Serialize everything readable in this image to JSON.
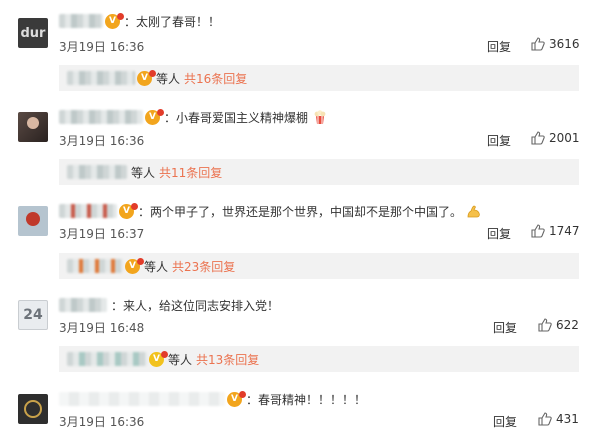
{
  "comments": [
    {
      "text": "：太刚了春哥！！",
      "time": "3月19日 16:36",
      "reply_label": "回复",
      "likes": "3616",
      "avatar_text": "dur",
      "vip_badge": "V",
      "sub": {
        "suffix_text": "等人",
        "count_text": "共16条回复"
      }
    },
    {
      "text": "：小春哥爱国主义精神爆棚",
      "time": "3月19日 16:36",
      "reply_label": "回复",
      "likes": "2001",
      "vip_badge": "V",
      "emoji": "popcorn-emoji",
      "sub": {
        "suffix_text": "等人",
        "count_text": "共11条回复"
      }
    },
    {
      "text": "：两个甲子了，世界还是那个世界，中国却不是那个中国了。",
      "time": "3月19日 16:37",
      "reply_label": "回复",
      "likes": "1747",
      "vip_badge": "V",
      "emoji": "strong-arm-emoji",
      "sub": {
        "suffix_text": "等人",
        "count_text": "共23条回复"
      }
    },
    {
      "text": "：来人，给这位同志安排入党！",
      "time": "3月19日 16:48",
      "reply_label": "回复",
      "likes": "622",
      "avatar_text": "24",
      "sub": {
        "suffix_text": "等人",
        "count_text": "共13条回复"
      }
    },
    {
      "text": "：春哥精神！！！！！",
      "time": "3月19日 16:36",
      "reply_label": "回复",
      "likes": "431",
      "vip_badge": "V"
    }
  ],
  "colors": {
    "link": "#eb7350",
    "subreply_bg": "#f2f2f2",
    "vip_badge": "#f2a51d"
  }
}
